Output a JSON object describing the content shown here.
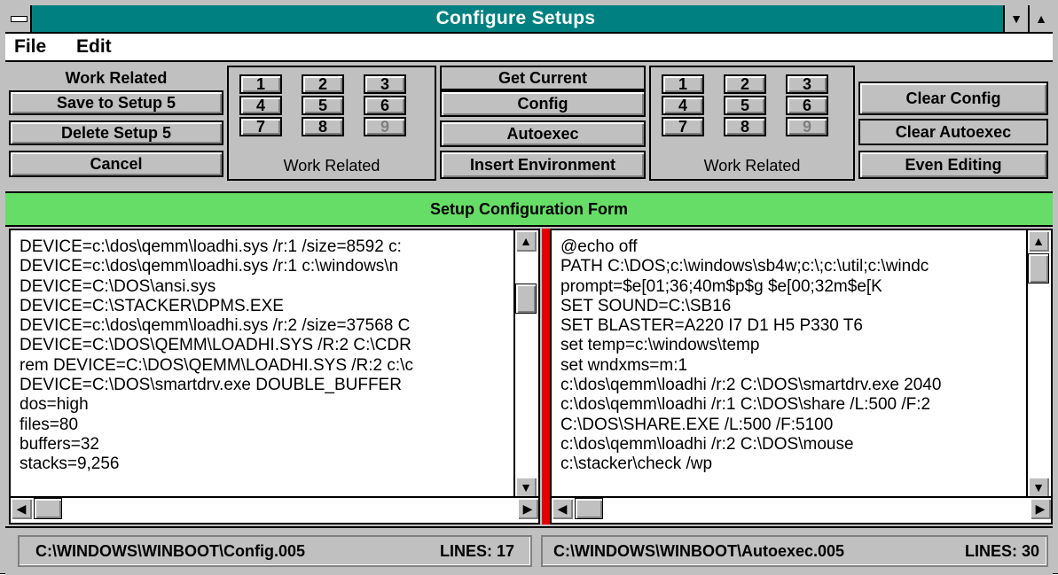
{
  "window": {
    "title": "Configure Setups"
  },
  "menubar": {
    "file": "File",
    "edit": "Edit"
  },
  "left_controls": {
    "setup_name": "Work Related",
    "save": "Save to Setup 5",
    "delete": "Delete Setup 5",
    "cancel": "Cancel"
  },
  "left_setups": {
    "numbers": [
      "1",
      "2",
      "3",
      "4",
      "5",
      "6",
      "7",
      "8",
      "9"
    ],
    "label": "Work Related"
  },
  "center_controls": {
    "get_current": "Get Current",
    "config": "Config",
    "autoexec": "Autoexec",
    "insert_env": "Insert Environment"
  },
  "right_setups": {
    "numbers": [
      "1",
      "2",
      "3",
      "4",
      "5",
      "6",
      "7",
      "8",
      "9"
    ],
    "label": "Work Related"
  },
  "right_controls": {
    "clear_config": "Clear Config",
    "clear_autoexec": "Clear Autoexec",
    "even_editing": "Even Editing"
  },
  "form_title": "Setup Configuration Form",
  "config_lines": [
    "DEVICE=c:\\dos\\qemm\\loadhi.sys /r:1 /size=8592 c:",
    "DEVICE=c:\\dos\\qemm\\loadhi.sys /r:1 c:\\windows\\n",
    "DEVICE=C:\\DOS\\ansi.sys",
    "DEVICE=C:\\STACKER\\DPMS.EXE",
    "DEVICE=c:\\dos\\qemm\\loadhi.sys /r:2 /size=37568 C",
    "DEVICE=C:\\DOS\\QEMM\\LOADHI.SYS /R:2 C:\\CDR",
    "rem DEVICE=C:\\DOS\\QEMM\\LOADHI.SYS /R:2 c:\\c",
    "DEVICE=C:\\DOS\\smartdrv.exe DOUBLE_BUFFER",
    "dos=high",
    "files=80",
    "buffers=32",
    "stacks=9,256"
  ],
  "autoexec_lines": [
    "@echo off",
    "PATH C:\\DOS;c:\\windows\\sb4w;c:\\;c:\\util;c:\\windc",
    "prompt=$e[01;36;40m$p$g $e[00;32m$e[K",
    "SET SOUND=C:\\SB16",
    "SET BLASTER=A220 I7 D1 H5 P330 T6",
    "set temp=c:\\windows\\temp",
    "set wndxms=m:1",
    "c:\\dos\\qemm\\loadhi /r:2 C:\\DOS\\smartdrv.exe 2040",
    "c:\\dos\\qemm\\loadhi /r:1 C:\\DOS\\share /L:500 /F:2",
    "C:\\DOS\\SHARE.EXE /L:500 /F:5100",
    "c:\\dos\\qemm\\loadhi /r:2 C:\\DOS\\mouse",
    "c:\\stacker\\check /wp"
  ],
  "status": {
    "config_path": "C:\\WINDOWS\\WINBOOT\\Config.005",
    "config_lines": "LINES: 17",
    "autoexec_path": "C:\\WINDOWS\\WINBOOT\\Autoexec.005",
    "autoexec_lines": "LINES: 30"
  },
  "colors": {
    "titlebar": "#008080",
    "form_title": "#66dd66",
    "splitter": "#e00000",
    "face": "#c0c0c0"
  }
}
